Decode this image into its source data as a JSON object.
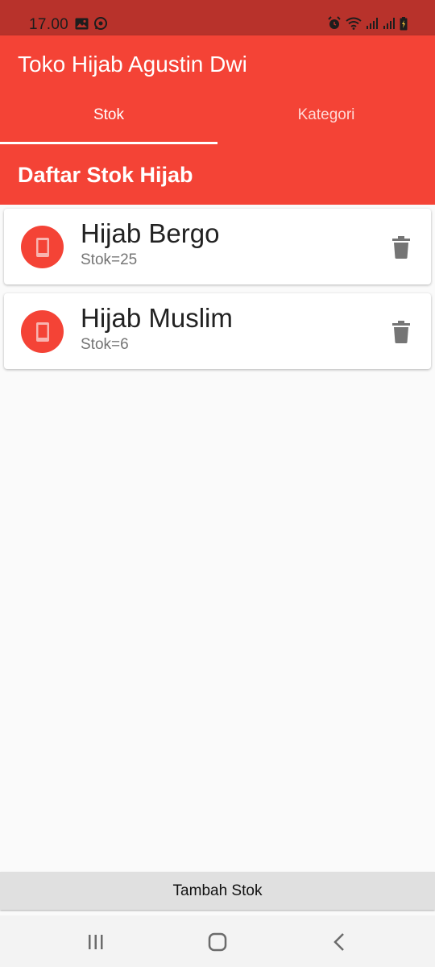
{
  "status_bar": {
    "time": "17.00",
    "icons": [
      "gallery-icon",
      "whatsapp-icon",
      "alarm-icon",
      "wifi-icon",
      "signal-icon",
      "signal-icon",
      "battery-charging-icon"
    ]
  },
  "app_bar": {
    "title": "Toko Hijab Agustin Dwi",
    "tabs": [
      {
        "label": "Stok",
        "selected": true
      },
      {
        "label": "Kategori",
        "selected": false
      }
    ]
  },
  "section": {
    "title": "Daftar Stok Hijab"
  },
  "items": [
    {
      "name": "Hijab Bergo",
      "stock": "Stok=25",
      "icon": "phone-icon",
      "action_icon": "trash-icon"
    },
    {
      "name": "Hijab Muslim",
      "stock": "Stok=6",
      "icon": "phone-icon",
      "action_icon": "trash-icon"
    }
  ],
  "add_button": {
    "label": "Tambah Stok"
  },
  "nav_bar": {
    "items": [
      "recents-icon",
      "home-icon",
      "back-icon"
    ]
  },
  "colors": {
    "primary": "#f44336",
    "status_bar": "#b8322b",
    "background": "#fafafa",
    "button": "#e0e0e0"
  }
}
